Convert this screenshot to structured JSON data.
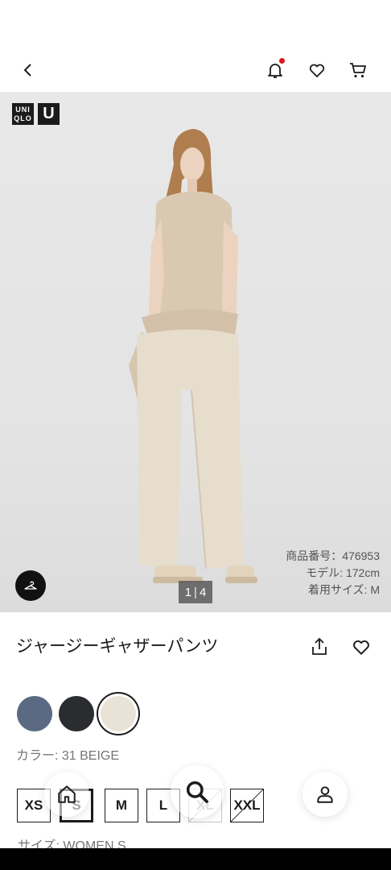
{
  "header": {
    "back_icon": "chevron-left-icon",
    "notification_icon": "bell-icon",
    "favorites_icon": "heart-icon",
    "cart_icon": "cart-icon",
    "has_notification": true
  },
  "brand": {
    "logo_top": "UNI",
    "logo_bottom": "QLO",
    "sub_logo": "U"
  },
  "image": {
    "current": "1",
    "total": "4",
    "product_number": "商品番号：476953",
    "model_height": "モデル: 172cm",
    "model_size": "着用サイズ: M"
  },
  "product": {
    "name": "ジャージーギャザーパンツ",
    "colors": [
      {
        "hex": "#5b6a82"
      },
      {
        "hex": "#2b2c30"
      },
      {
        "hex": "#e9e2d6",
        "selected": true
      }
    ],
    "color_label": "カラー: 31 BEIGE",
    "sizes": [
      {
        "label": "XS"
      },
      {
        "label": "S",
        "selected": true
      },
      {
        "label": "M"
      },
      {
        "label": "L"
      },
      {
        "label": "XL",
        "unavailable": true
      },
      {
        "label": "XXL",
        "unavailable": true
      }
    ],
    "size_label": "サイズ: WOMEN S"
  },
  "nav": {
    "home_icon": "home-icon",
    "search_icon": "search-icon",
    "account_icon": "user-icon"
  }
}
